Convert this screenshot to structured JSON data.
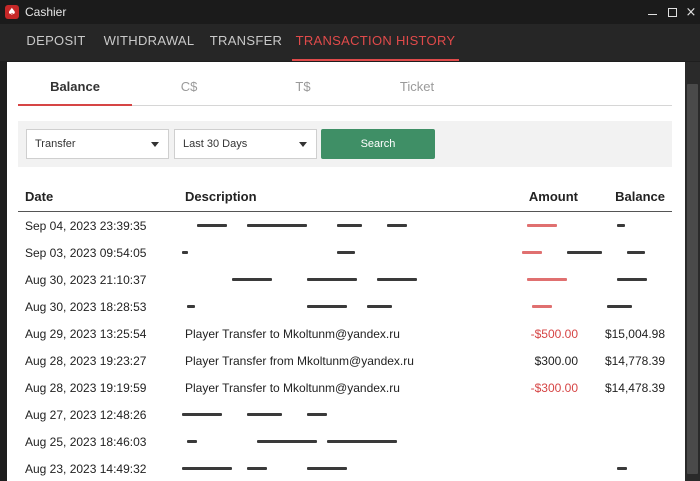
{
  "window": {
    "title": "Cashier",
    "app_icon": "♠",
    "controls": {
      "minimize": "minimize-icon",
      "maximize": "maximize-icon",
      "close": "×"
    }
  },
  "main_tabs": [
    {
      "label": "DEPOSIT",
      "active": false
    },
    {
      "label": "WITHDRAWAL",
      "active": false
    },
    {
      "label": "TRANSFER",
      "active": false
    },
    {
      "label": "TRANSACTION HISTORY",
      "active": true
    }
  ],
  "sub_tabs": [
    {
      "label": "Balance",
      "active": true
    },
    {
      "label": "C$",
      "active": false
    },
    {
      "label": "T$",
      "active": false
    },
    {
      "label": "Ticket",
      "active": false
    }
  ],
  "filters": {
    "type_value": "Transfer",
    "range_value": "Last 30 Days",
    "search_label": "Search"
  },
  "table": {
    "columns": {
      "date": "Date",
      "description": "Description",
      "amount": "Amount",
      "balance": "Balance"
    },
    "rows": [
      {
        "date": "Sep 04, 2023 23:39:35",
        "description": "",
        "amount": "",
        "balance": "",
        "redacted": true
      },
      {
        "date": "Sep 03, 2023 09:54:05",
        "description": "",
        "amount": "",
        "balance": "",
        "redacted": true
      },
      {
        "date": "Aug 30, 2023 21:10:37",
        "description": "",
        "amount": "",
        "balance": "",
        "redacted": true
      },
      {
        "date": "Aug 30, 2023 18:28:53",
        "description": "",
        "amount": "",
        "balance": "",
        "redacted": true
      },
      {
        "date": "Aug 29, 2023 13:25:54",
        "description": "Player Transfer to Mkoltunm@yandex.ru",
        "amount": "-$500.00",
        "balance": "$15,004.98",
        "redacted": false
      },
      {
        "date": "Aug 28, 2023 19:23:27",
        "description": "Player Transfer from Mkoltunm@yandex.ru",
        "amount": "$300.00",
        "balance": "$14,778.39",
        "redacted": false
      },
      {
        "date": "Aug 28, 2023 19:19:59",
        "description": "Player Transfer to Mkoltunm@yandex.ru",
        "amount": "-$300.00",
        "balance": "$14,478.39",
        "redacted": false
      },
      {
        "date": "Aug 27, 2023 12:48:26",
        "description": "",
        "amount": "",
        "balance": "",
        "redacted": true
      },
      {
        "date": "Aug 25, 2023 18:46:03",
        "description": "",
        "amount": "",
        "balance": "",
        "redacted": true
      },
      {
        "date": "Aug 23, 2023 14:49:32",
        "description": "",
        "amount": "",
        "balance": "",
        "redacted": true
      }
    ]
  },
  "colors": {
    "accent_red": "#e04a4a",
    "negative_amount": "#d64545",
    "search_button": "#3f8f66",
    "titlebar": "#1b1b1b",
    "nav_background": "#262626"
  }
}
